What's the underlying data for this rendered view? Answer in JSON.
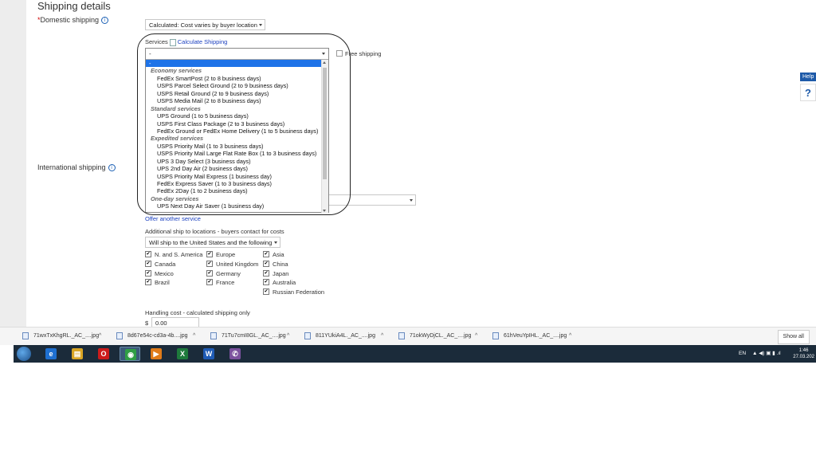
{
  "section": {
    "title": "Shipping details"
  },
  "domestic": {
    "required_mark": "*",
    "label": "Domestic shipping",
    "info_icon": "i",
    "cost_type": "Calculated: Cost varies by buyer location",
    "services_label": "Services",
    "calculate_link": "Calculate Shipping",
    "free_shipping_label": "Free shipping"
  },
  "service_dropdown": {
    "current": "-",
    "options": [
      {
        "kind": "sel",
        "text": "-"
      },
      {
        "kind": "group",
        "text": "Economy services"
      },
      {
        "kind": "item",
        "text": "FedEx SmartPost (2 to 8 business days)"
      },
      {
        "kind": "item",
        "text": "USPS Parcel Select Ground (2 to 9 business days)"
      },
      {
        "kind": "item",
        "text": "USPS Retail Ground (2 to 9 business days)"
      },
      {
        "kind": "item",
        "text": "USPS Media Mail (2 to 8 business days)"
      },
      {
        "kind": "group",
        "text": "Standard services"
      },
      {
        "kind": "item",
        "text": "UPS Ground (1 to 5 business days)"
      },
      {
        "kind": "item",
        "text": "USPS First Class Package (2 to 3 business days)"
      },
      {
        "kind": "item",
        "text": "FedEx Ground or FedEx Home Delivery (1 to 5 business days)"
      },
      {
        "kind": "group",
        "text": "Expedited services"
      },
      {
        "kind": "item",
        "text": "USPS Priority Mail (1 to 3 business days)"
      },
      {
        "kind": "item",
        "text": "USPS Priority Mail Large Flat Rate Box (1 to 3 business days)"
      },
      {
        "kind": "item",
        "text": "UPS 3 Day Select (3 business days)"
      },
      {
        "kind": "item",
        "text": "UPS 2nd Day Air (2 business days)"
      },
      {
        "kind": "item",
        "text": "USPS Priority Mail Express (1 business day)"
      },
      {
        "kind": "item",
        "text": "FedEx Express Saver (1 to 3 business days)"
      },
      {
        "kind": "item",
        "text": "FedEx 2Day (1 to 2 business days)"
      },
      {
        "kind": "group",
        "text": "One-day services"
      },
      {
        "kind": "item",
        "text": "UPS Next Day Air Saver (1 business day)"
      }
    ]
  },
  "international": {
    "label": "International shipping",
    "info_icon": "i",
    "offer_another": "Offer another service",
    "additional_label": "Additional ship to locations - buyers contact for costs",
    "ship_to_select": "Will ship to the United States and the following",
    "locations": [
      [
        {
          "label": "N. and S. America",
          "checked": true
        },
        {
          "label": "Canada",
          "checked": true
        },
        {
          "label": "Mexico",
          "checked": true
        },
        {
          "label": "Brazil",
          "checked": true
        }
      ],
      [
        {
          "label": "Europe",
          "checked": true
        },
        {
          "label": "United Kingdom",
          "checked": true
        },
        {
          "label": "Germany",
          "checked": true
        },
        {
          "label": "France",
          "checked": true
        }
      ],
      [
        {
          "label": "Asia",
          "checked": true
        },
        {
          "label": "China",
          "checked": true
        },
        {
          "label": "Japan",
          "checked": true
        },
        {
          "label": "Australia",
          "checked": true
        },
        {
          "label": "Russian Federation",
          "checked": true
        }
      ]
    ],
    "handling_label": "Handling cost - calculated shipping only",
    "currency": "$",
    "handling_value": "0.00"
  },
  "help": {
    "tab": "Help",
    "icon": "?"
  },
  "downloads": {
    "items": [
      "71wxTxKhgRL._AC_....jpg",
      "8d67e54c-cd3a-4b....jpg",
      "71Tu7cmI8GL._AC_....jpg",
      "811YUkiA4L._AC_....jpg",
      "71okWyDjCL._AC_....jpg",
      "61hVeuYpIHL._AC_....jpg"
    ],
    "show_all": "Show all"
  },
  "taskbar": {
    "apps": [
      {
        "name": "ie-icon",
        "glyph": "e",
        "color": "#1e6fd0"
      },
      {
        "name": "explorer-icon",
        "glyph": "▤",
        "color": "#d9a524"
      },
      {
        "name": "opera-icon",
        "glyph": "O",
        "color": "#cc1b1b"
      },
      {
        "name": "chrome-icon",
        "glyph": "◉",
        "color": "#2f9e44"
      },
      {
        "name": "media-player-icon",
        "glyph": "▶",
        "color": "#e07b19"
      },
      {
        "name": "excel-icon",
        "glyph": "X",
        "color": "#1e7a3c"
      },
      {
        "name": "word-icon",
        "glyph": "W",
        "color": "#1f5bb5"
      },
      {
        "name": "viber-icon",
        "glyph": "✆",
        "color": "#7b519d"
      }
    ],
    "language": "EN",
    "time": "1:46",
    "date": "27.03.202"
  }
}
